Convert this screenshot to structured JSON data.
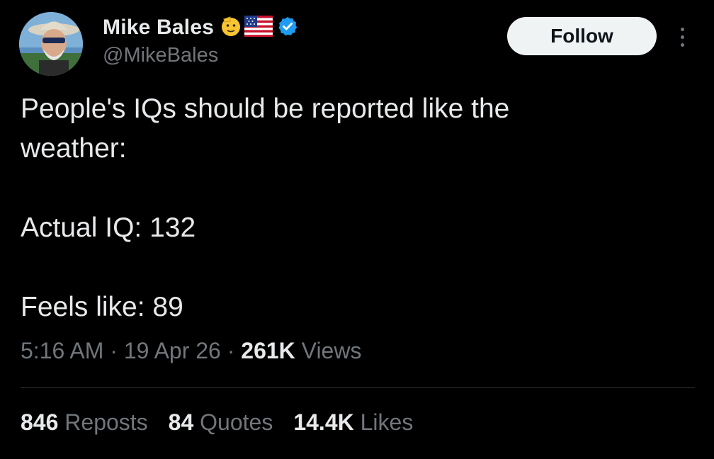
{
  "author": {
    "display_name": "Mike Bales",
    "handle": "@MikeBales",
    "emojis": [
      "saluting-face-emoji",
      "us-flag-emoji"
    ],
    "verified": true,
    "verified_color": "#1d9bf0"
  },
  "follow_button": {
    "label": "Follow"
  },
  "tweet": {
    "lines": [
      "People's IQs should be reported like the",
      "weather:",
      "Actual IQ: 132",
      "Feels like: 89"
    ]
  },
  "meta": {
    "time": "5:16 AM",
    "separator": "·",
    "date": "19 Apr 26",
    "views_count": "261K",
    "views_label": "Views"
  },
  "stats": {
    "reposts": {
      "count": "846",
      "label": "Reposts"
    },
    "quotes": {
      "count": "84",
      "label": "Quotes"
    },
    "likes": {
      "count": "14.4K",
      "label": "Likes"
    }
  },
  "colors": {
    "background": "#000000",
    "text": "#e7e9ea",
    "muted": "#71767b",
    "divider": "#2f3336",
    "button_bg": "#eff3f4"
  }
}
